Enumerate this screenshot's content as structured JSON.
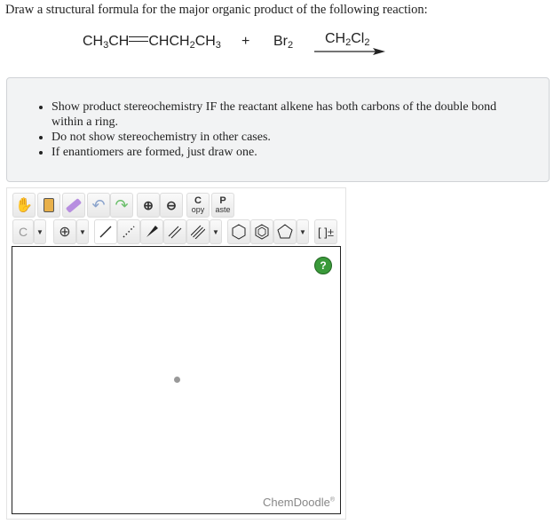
{
  "question": "Draw a structural formula for the major organic product of the following reaction:",
  "reaction": {
    "reactant1": [
      "CH",
      "3",
      "CH",
      "CHCH",
      "2",
      "CH",
      "3"
    ],
    "plus": "+",
    "reactant2": [
      "Br",
      "2"
    ],
    "solvent": [
      "CH",
      "2",
      "Cl",
      "2"
    ]
  },
  "instructions": [
    "Show product stereochemistry IF the reactant alkene has both carbons of the double bond within a ring.",
    "Do not show stereochemistry in other cases.",
    "If enantiomers are formed, just draw one."
  ],
  "toolbar": {
    "copy_top": "C",
    "copy_bottom": "opy",
    "paste_top": "P",
    "paste_bottom": "aste",
    "atom": "C",
    "charge": "[ ]±"
  },
  "canvas": {
    "help": "?",
    "logo": "ChemDoodle",
    "logo_mark": "®"
  }
}
